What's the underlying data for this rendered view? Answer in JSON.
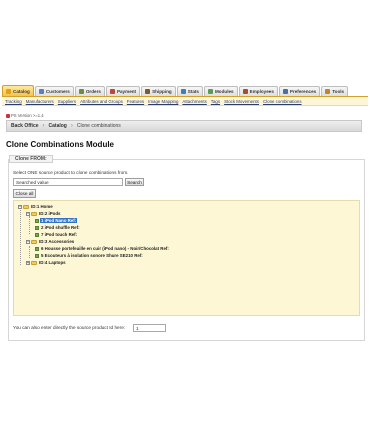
{
  "tabs": [
    {
      "label": "Catalog",
      "icon": "catalog-icon",
      "color": "#e0a21e",
      "active": true
    },
    {
      "label": "Customers",
      "icon": "customers-icon",
      "color": "#5b7fbf",
      "active": false
    },
    {
      "label": "Orders",
      "icon": "orders-icon",
      "color": "#6a8d3f",
      "active": false
    },
    {
      "label": "Payment",
      "icon": "payment-icon",
      "color": "#b34a3a",
      "active": false
    },
    {
      "label": "Shipping",
      "icon": "shipping-icon",
      "color": "#7a5a2e",
      "active": false
    },
    {
      "label": "Stats",
      "icon": "stats-icon",
      "color": "#3f7fb3",
      "active": false
    },
    {
      "label": "Modules",
      "icon": "modules-icon",
      "color": "#5a9a5a",
      "active": false
    },
    {
      "label": "Employees",
      "icon": "employees-icon",
      "color": "#a0522d",
      "active": false
    },
    {
      "label": "Preferences",
      "icon": "preferences-icon",
      "color": "#4a6fa5",
      "active": false
    },
    {
      "label": "Tools",
      "icon": "tools-icon",
      "color": "#b58a2e",
      "active": false
    }
  ],
  "subnav": [
    "Tracking",
    "Manufacturers",
    "Suppliers",
    "Attributes and Groups",
    "Features",
    "Image Mapping",
    "Attachments",
    "Tags",
    "Stock Movements",
    "Clone combinations"
  ],
  "version": "PS Version >=1.4",
  "breadcrumb": {
    "root": "Back Office",
    "parent": "Catalog",
    "current": "Clone combinations"
  },
  "page_title": "Clone Combinations Module",
  "fieldset_legend": "Clone FROM:",
  "instruction": "Select ONE source product to clone combinations from.",
  "search": {
    "value": "Searched value",
    "button": "Search"
  },
  "close_all_label": "Close all",
  "tree": {
    "root": "ID:1 Home",
    "categories": [
      {
        "label": "ID:2 iPods",
        "products": [
          {
            "label": "1 iPod Nano Ref:",
            "selected": true
          },
          {
            "label": "2 iPod shuffle Ref:",
            "selected": false
          },
          {
            "label": "7 iPod touch Ref:",
            "selected": false
          }
        ]
      },
      {
        "label": "ID:3 Accessories",
        "products": [
          {
            "label": "6 Housse portefeuille en cuir (iPod nano) - Noir/Chocolat Ref:",
            "selected": false
          },
          {
            "label": "5 Ecouteurs à isolation sonore Shure SE210 Ref:",
            "selected": false
          }
        ]
      },
      {
        "label": "ID:4 Laptops",
        "products": []
      }
    ]
  },
  "direct_entry": {
    "label": "You can also enter directly the source product Id here:",
    "value": "1"
  },
  "colors": {
    "accent": "#f6c34a",
    "selected": "#3173c6",
    "tree_bg": "#fdf7d6"
  }
}
